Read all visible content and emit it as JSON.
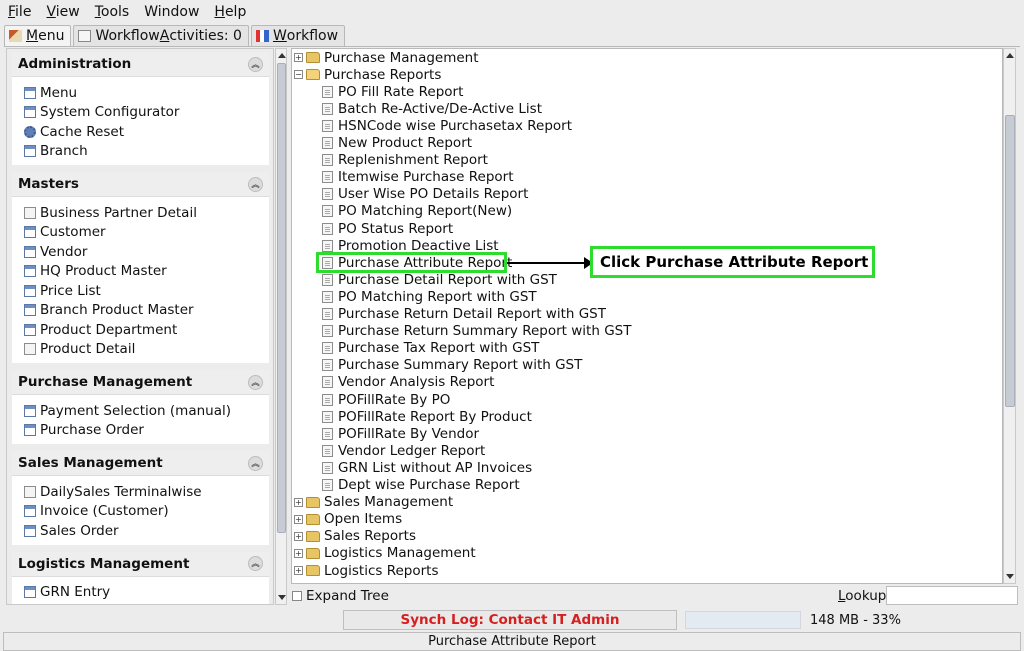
{
  "menubar": [
    {
      "pre": "",
      "key": "F",
      "post": "ile"
    },
    {
      "pre": "",
      "key": "V",
      "post": "iew"
    },
    {
      "pre": "",
      "key": "T",
      "post": "ools"
    },
    {
      "pre": "",
      "key": "",
      "post": "Window"
    },
    {
      "pre": "",
      "key": "H",
      "post": "elp"
    }
  ],
  "tabs": [
    {
      "key": "M",
      "rest": "enu",
      "icon": "home-icon"
    },
    {
      "pre": "Workflow ",
      "key": "A",
      "rest": "ctivities: 0",
      "icon": "workflow-activities-icon"
    },
    {
      "pre": "",
      "key": "W",
      "rest": "orkflow",
      "icon": "workflow-icon"
    }
  ],
  "left_panel": {
    "sections": [
      {
        "title": "Administration",
        "items": [
          {
            "label": "Menu",
            "icon": "window-icon"
          },
          {
            "label": "System Configurator",
            "icon": "window-icon"
          },
          {
            "label": "Cache Reset",
            "icon": "gear-icon"
          },
          {
            "label": "Branch",
            "icon": "window-icon"
          }
        ]
      },
      {
        "title": "Masters",
        "items": [
          {
            "label": "Business Partner Detail",
            "icon": "document-icon"
          },
          {
            "label": "Customer",
            "icon": "window-icon"
          },
          {
            "label": "Vendor",
            "icon": "window-icon"
          },
          {
            "label": "HQ Product Master",
            "icon": "window-icon"
          },
          {
            "label": "Price List",
            "icon": "window-icon"
          },
          {
            "label": "Branch Product Master",
            "icon": "window-icon"
          },
          {
            "label": "Product Department",
            "icon": "window-icon"
          },
          {
            "label": "Product Detail",
            "icon": "document-icon"
          }
        ]
      },
      {
        "title": "Purchase Management",
        "items": [
          {
            "label": "Payment Selection (manual)",
            "icon": "window-icon"
          },
          {
            "label": "Purchase Order",
            "icon": "window-icon"
          }
        ]
      },
      {
        "title": "Sales Management",
        "items": [
          {
            "label": "DailySales Terminalwise",
            "icon": "document-icon"
          },
          {
            "label": "Invoice (Customer)",
            "icon": "window-icon"
          },
          {
            "label": "Sales Order",
            "icon": "window-icon"
          }
        ]
      },
      {
        "title": "Logistics Management",
        "items": [
          {
            "label": "GRN Entry",
            "icon": "window-icon"
          }
        ]
      }
    ]
  },
  "tree": {
    "top_nodes_before": [
      {
        "label": "Purchase Management",
        "expanded": false
      }
    ],
    "open_node": {
      "label": "Purchase Reports",
      "expanded": true
    },
    "children": [
      "PO Fill Rate Report",
      "Batch Re-Active/De-Active List",
      "HSNCode wise Purchasetax Report",
      "New Product Report",
      "Replenishment Report",
      "Itemwise Purchase Report",
      "User Wise PO Details Report",
      "PO Matching Report(New)",
      "PO Status Report",
      "Promotion Deactive List",
      "Purchase Attribute Report",
      "Purchase Detail Report with GST",
      "PO Matching Report with GST",
      "Purchase Return Detail Report with GST",
      "Purchase Return Summary Report with GST",
      "Purchase Tax Report with GST",
      "Purchase Summary Report with GST",
      "Vendor Analysis Report",
      "POFillRate By PO",
      "POFillRate Report By Product",
      "POFillRate By Vendor",
      "Vendor Ledger Report",
      "GRN List without AP Invoices",
      "Dept wise Purchase Report"
    ],
    "top_nodes_after": [
      {
        "label": "Sales Management",
        "expanded": false
      },
      {
        "label": "Open Items",
        "expanded": false
      },
      {
        "label": "Sales Reports",
        "expanded": false
      },
      {
        "label": "Logistics Management",
        "expanded": false
      },
      {
        "label": "Logistics Reports",
        "expanded": false
      }
    ],
    "selected_index": 10
  },
  "callout": {
    "text": "Click Purchase Attribute Report",
    "border_color": "#2edc2e"
  },
  "bottom": {
    "expand_tree_label": "Expand Tree",
    "lookup_label": "Lookup",
    "lookup_value": "",
    "synch_log": "Synch Log: Contact IT Admin",
    "memory": "148 MB - 33%",
    "memory_percent": 33,
    "status": "Purchase Attribute Report"
  },
  "colors": {
    "synch_text": "#d62020",
    "highlight": "#2edc2e"
  }
}
